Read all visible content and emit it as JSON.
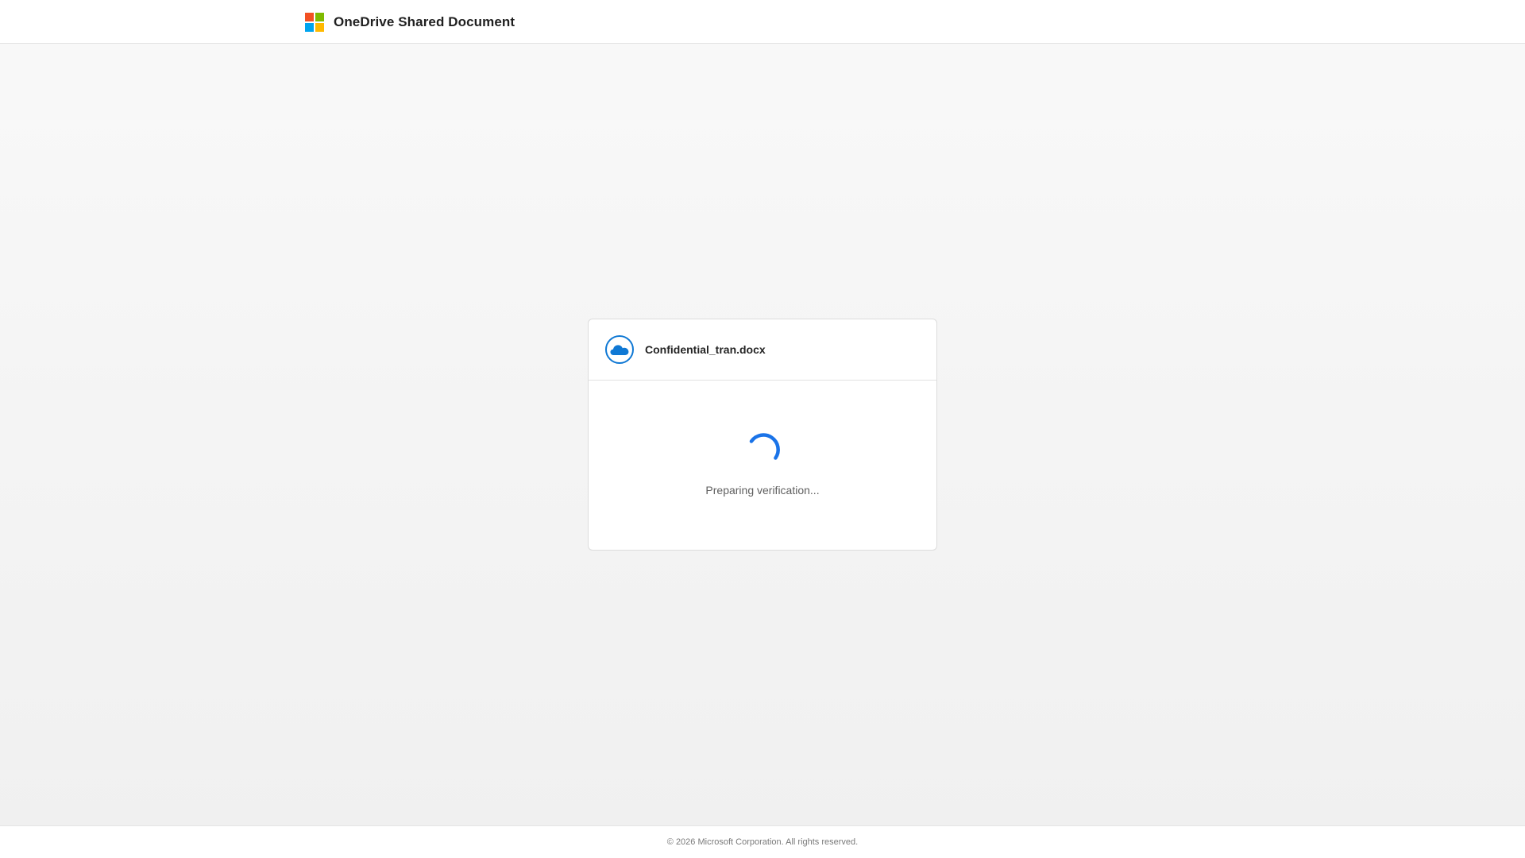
{
  "header": {
    "title": "OneDrive Shared Document",
    "logo_icon": "microsoft-logo-icon",
    "logo_colors": [
      "#f25022",
      "#7fba00",
      "#00a4ef",
      "#ffb900"
    ]
  },
  "card": {
    "file_icon": "onedrive-cloud-icon",
    "file_name": "Confidential_tran.docx",
    "spinner_icon": "loading-spinner-icon",
    "status_text": "Preparing verification...",
    "accent_color": "#0f78d4"
  },
  "footer": {
    "copyright": "© 2026 Microsoft Corporation. All rights reserved."
  }
}
